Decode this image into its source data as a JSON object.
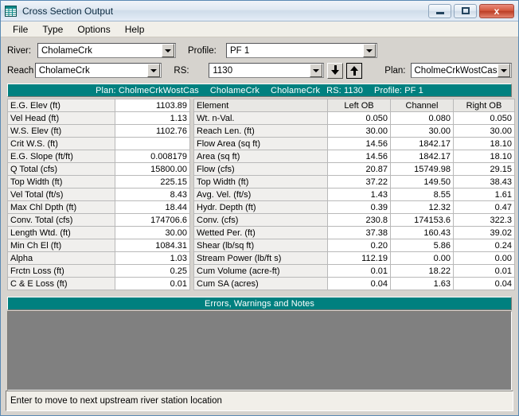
{
  "window": {
    "title": "Cross Section Output",
    "icon": "table-grid-icon",
    "minimize_label": "Minimize",
    "maximize_label": "Maximize",
    "close_label": "x"
  },
  "menu": {
    "items": [
      {
        "label": "File"
      },
      {
        "label": "Type"
      },
      {
        "label": "Options"
      },
      {
        "label": "Help"
      }
    ]
  },
  "selectors": {
    "river_label": "River:",
    "river_value": "CholameCrk",
    "reach_label": "Reach",
    "reach_value": "CholameCrk",
    "profile_label": "Profile:",
    "profile_value": "PF 1",
    "rs_label": "RS:",
    "rs_value": "1130",
    "plan_label": "Plan:",
    "plan_value": "CholmeCrkWostCas",
    "next_downstream_icon": "arrow-down-icon",
    "next_upstream_icon": "arrow-up-icon"
  },
  "plan_band": {
    "plan": "Plan: CholmeCrkWostCas",
    "river": "CholameCrk",
    "reach": "CholameCrk",
    "rs": "RS: 1130",
    "profile": "Profile: PF 1"
  },
  "left_table": {
    "rows": [
      {
        "label": "E.G. Elev (ft)",
        "value": "1103.89"
      },
      {
        "label": "Vel Head (ft)",
        "value": "1.13"
      },
      {
        "label": "W.S. Elev (ft)",
        "value": "1102.76"
      },
      {
        "label": "Crit W.S. (ft)",
        "value": ""
      },
      {
        "label": "E.G. Slope (ft/ft)",
        "value": "0.008179"
      },
      {
        "label": "Q Total (cfs)",
        "value": "15800.00"
      },
      {
        "label": "Top Width (ft)",
        "value": "225.15"
      },
      {
        "label": "Vel Total (ft/s)",
        "value": "8.43"
      },
      {
        "label": "Max Chl Dpth (ft)",
        "value": "18.44"
      },
      {
        "label": "Conv. Total (cfs)",
        "value": "174706.6"
      },
      {
        "label": "Length Wtd. (ft)",
        "value": "30.00"
      },
      {
        "label": "Min Ch El (ft)",
        "value": "1084.31"
      },
      {
        "label": "Alpha",
        "value": "1.03"
      },
      {
        "label": "Frctn Loss (ft)",
        "value": "0.25"
      },
      {
        "label": "C & E Loss (ft)",
        "value": "0.01"
      }
    ]
  },
  "right_table": {
    "headers": [
      "Element",
      "Left OB",
      "Channel",
      "Right OB"
    ],
    "rows": [
      {
        "label": "Wt. n-Val.",
        "left": "0.050",
        "channel": "0.080",
        "right": "0.050"
      },
      {
        "label": "Reach Len. (ft)",
        "left": "30.00",
        "channel": "30.00",
        "right": "30.00"
      },
      {
        "label": "Flow Area (sq ft)",
        "left": "14.56",
        "channel": "1842.17",
        "right": "18.10"
      },
      {
        "label": "Area (sq ft)",
        "left": "14.56",
        "channel": "1842.17",
        "right": "18.10"
      },
      {
        "label": "Flow (cfs)",
        "left": "20.87",
        "channel": "15749.98",
        "right": "29.15"
      },
      {
        "label": "Top Width (ft)",
        "left": "37.22",
        "channel": "149.50",
        "right": "38.43"
      },
      {
        "label": "Avg. Vel. (ft/s)",
        "left": "1.43",
        "channel": "8.55",
        "right": "1.61"
      },
      {
        "label": "Hydr. Depth (ft)",
        "left": "0.39",
        "channel": "12.32",
        "right": "0.47"
      },
      {
        "label": "Conv. (cfs)",
        "left": "230.8",
        "channel": "174153.6",
        "right": "322.3"
      },
      {
        "label": "Wetted Per. (ft)",
        "left": "37.38",
        "channel": "160.43",
        "right": "39.02"
      },
      {
        "label": "Shear (lb/sq ft)",
        "left": "0.20",
        "channel": "5.86",
        "right": "0.24"
      },
      {
        "label": "Stream Power (lb/ft s)",
        "left": "112.19",
        "channel": "0.00",
        "right": "0.00"
      },
      {
        "label": "Cum Volume (acre-ft)",
        "left": "0.01",
        "channel": "18.22",
        "right": "0.01"
      },
      {
        "label": "Cum SA (acres)",
        "left": "0.04",
        "channel": "1.63",
        "right": "0.04"
      }
    ]
  },
  "errors_panel": {
    "title": "Errors, Warnings and Notes",
    "content": ""
  },
  "statusbar": {
    "text": "Enter to move to next upstream river station location"
  },
  "colors": {
    "teal": "#00807f",
    "window_face": "#d6d3ce",
    "notes_background": "#808080",
    "close_button": "#bb3e26"
  }
}
